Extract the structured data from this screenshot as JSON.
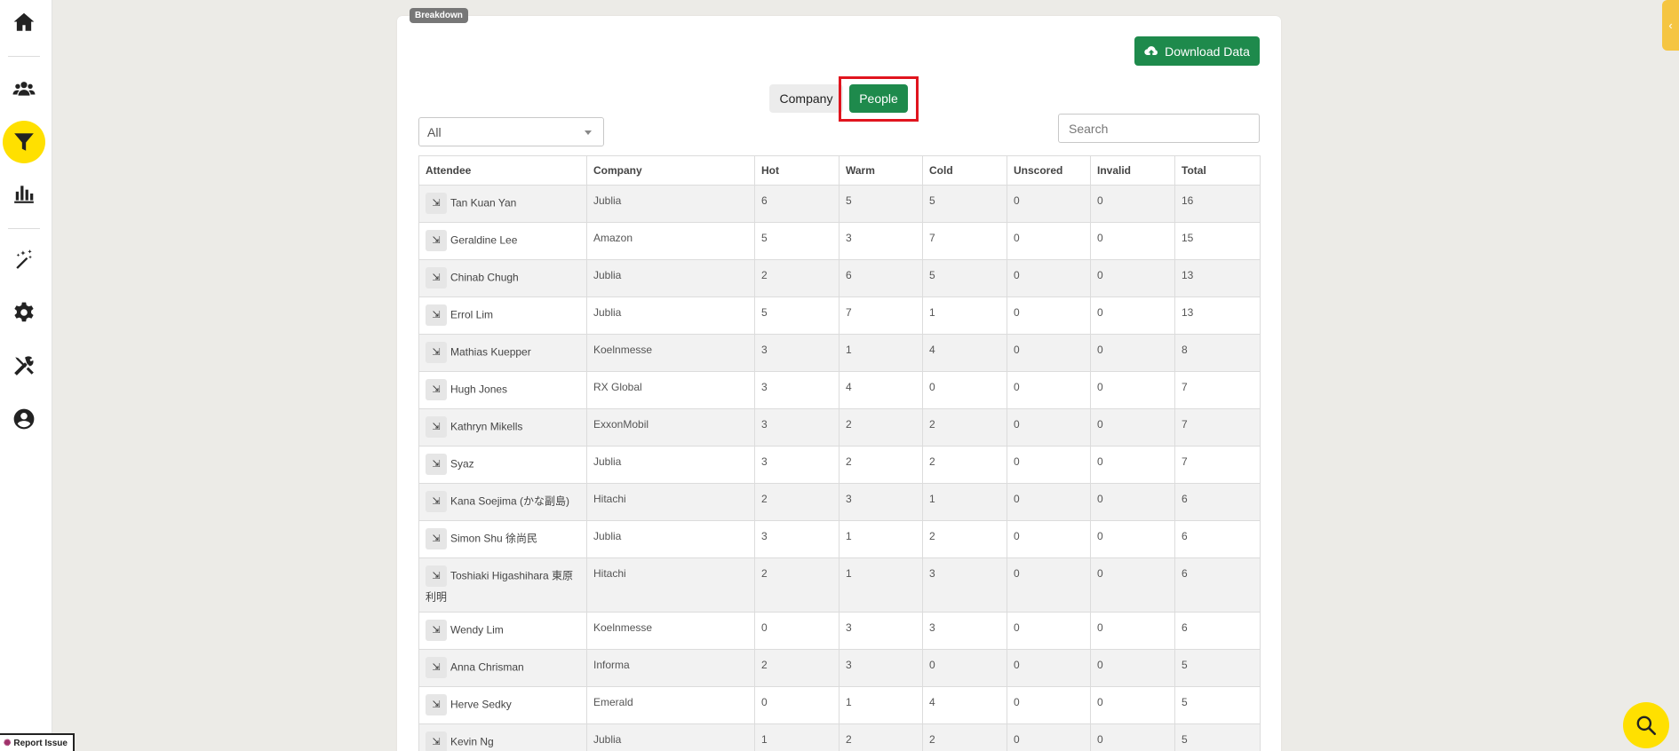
{
  "sidebar": {
    "items": [
      {
        "icon": "home-icon"
      },
      {
        "icon": "users-icon"
      },
      {
        "icon": "filter-icon",
        "active": true
      },
      {
        "icon": "bar-chart-icon"
      },
      {
        "icon": "magic-wand-icon"
      },
      {
        "icon": "gear-icon"
      },
      {
        "icon": "tools-icon"
      },
      {
        "icon": "user-circle-icon"
      }
    ],
    "accent_color": "#ffe000"
  },
  "card": {
    "badge": "Breakdown",
    "download_label": "Download Data",
    "toggle": {
      "company_label": "Company",
      "people_label": "People",
      "selected": "People"
    },
    "filter": {
      "value": "All"
    },
    "search": {
      "placeholder": "Search",
      "value": ""
    }
  },
  "table": {
    "headers": [
      "Attendee",
      "Company",
      "Hot",
      "Warm",
      "Cold",
      "Unscored",
      "Invalid",
      "Total"
    ],
    "rows": [
      {
        "name": "Tan Kuan Yan",
        "company": "Jublia",
        "hot": "6",
        "warm": "5",
        "cold": "5",
        "unscored": "0",
        "invalid": "0",
        "total": "16"
      },
      {
        "name": "Geraldine Lee",
        "company": "Amazon",
        "hot": "5",
        "warm": "3",
        "cold": "7",
        "unscored": "0",
        "invalid": "0",
        "total": "15"
      },
      {
        "name": "Chinab Chugh",
        "company": "Jublia",
        "hot": "2",
        "warm": "6",
        "cold": "5",
        "unscored": "0",
        "invalid": "0",
        "total": "13"
      },
      {
        "name": "Errol Lim",
        "company": "Jublia",
        "hot": "5",
        "warm": "7",
        "cold": "1",
        "unscored": "0",
        "invalid": "0",
        "total": "13"
      },
      {
        "name": "Mathias Kuepper",
        "company": "Koelnmesse",
        "hot": "3",
        "warm": "1",
        "cold": "4",
        "unscored": "0",
        "invalid": "0",
        "total": "8"
      },
      {
        "name": "Hugh Jones",
        "company": "RX Global",
        "hot": "3",
        "warm": "4",
        "cold": "0",
        "unscored": "0",
        "invalid": "0",
        "total": "7"
      },
      {
        "name": "Kathryn Mikells",
        "company": "ExxonMobil",
        "hot": "3",
        "warm": "2",
        "cold": "2",
        "unscored": "0",
        "invalid": "0",
        "total": "7"
      },
      {
        "name": "Syaz",
        "company": "Jublia",
        "hot": "3",
        "warm": "2",
        "cold": "2",
        "unscored": "0",
        "invalid": "0",
        "total": "7"
      },
      {
        "name": "Kana Soejima (かな副島)",
        "company": "Hitachi",
        "hot": "2",
        "warm": "3",
        "cold": "1",
        "unscored": "0",
        "invalid": "0",
        "total": "6"
      },
      {
        "name": "Simon Shu 徐尚民",
        "company": "Jublia",
        "hot": "3",
        "warm": "1",
        "cold": "2",
        "unscored": "0",
        "invalid": "0",
        "total": "6"
      },
      {
        "name": "Toshiaki Higashihara 東原利明",
        "company": "Hitachi",
        "hot": "2",
        "warm": "1",
        "cold": "3",
        "unscored": "0",
        "invalid": "0",
        "total": "6"
      },
      {
        "name": "Wendy Lim",
        "company": "Koelnmesse",
        "hot": "0",
        "warm": "3",
        "cold": "3",
        "unscored": "0",
        "invalid": "0",
        "total": "6"
      },
      {
        "name": "Anna Chrisman",
        "company": "Informa",
        "hot": "2",
        "warm": "3",
        "cold": "0",
        "unscored": "0",
        "invalid": "0",
        "total": "5"
      },
      {
        "name": "Herve Sedky",
        "company": "Emerald",
        "hot": "0",
        "warm": "1",
        "cold": "4",
        "unscored": "0",
        "invalid": "0",
        "total": "5"
      },
      {
        "name": "Kevin Ng",
        "company": "Jublia",
        "hot": "1",
        "warm": "2",
        "cold": "2",
        "unscored": "0",
        "invalid": "0",
        "total": "5"
      }
    ]
  },
  "footer": {
    "report_issue": "Report Issue"
  },
  "colors": {
    "primary_green": "#1e8a4c",
    "highlight_red": "#e0141e",
    "fab_yellow": "#ffe000"
  }
}
